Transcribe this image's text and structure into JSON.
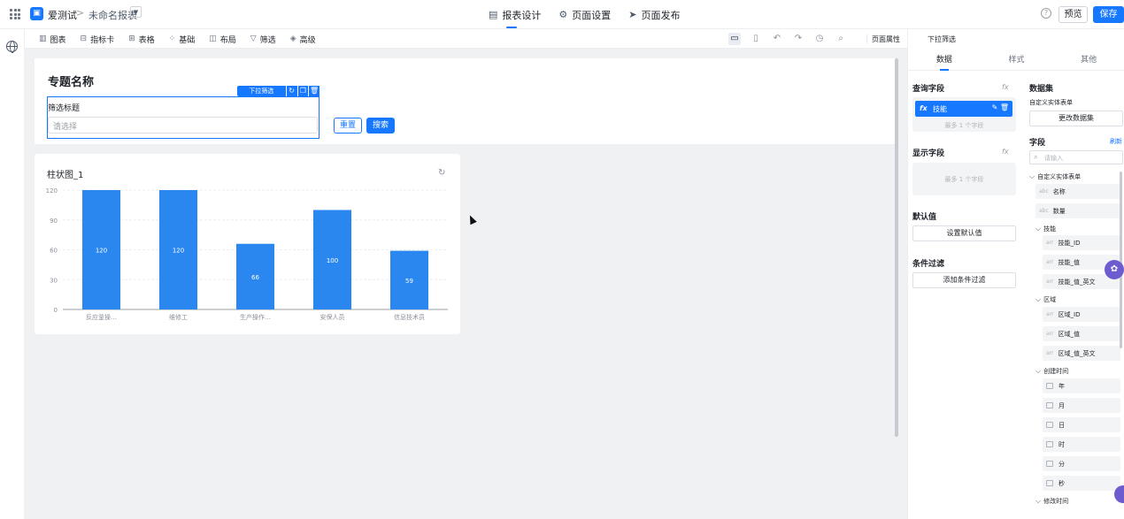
{
  "topbar": {
    "app_name": "爱测试",
    "crumb_sep": ">",
    "report_name": "未命名报表",
    "tabs": [
      {
        "label": "报表设计",
        "icon": "report-design-icon"
      },
      {
        "label": "页面设置",
        "icon": "gear-icon"
      },
      {
        "label": "页面发布",
        "icon": "send-icon"
      }
    ],
    "preview_label": "预览",
    "save_label": "保存"
  },
  "toolbar": {
    "items": [
      {
        "label": "图表",
        "icon": "bar-chart-icon"
      },
      {
        "label": "指标卡",
        "icon": "indicator-card-icon"
      },
      {
        "label": "表格",
        "icon": "table-icon"
      },
      {
        "label": "基础",
        "icon": "basic-grid-icon"
      },
      {
        "label": "布局",
        "icon": "layout-icon"
      },
      {
        "label": "筛选",
        "icon": "filter-icon"
      },
      {
        "label": "高级",
        "icon": "advanced-layers-icon"
      }
    ],
    "page_prop_label": "页面属性"
  },
  "canvas": {
    "topic_title": "专题名称",
    "filter": {
      "title": "筛选标题",
      "placeholder": "请选择",
      "tag_label": "下拉筛选"
    },
    "reset_label": "重置",
    "search_label": "搜索"
  },
  "chart_data": {
    "type": "bar",
    "title": "柱状图_1",
    "categories": [
      "反应釜操…",
      "维修工",
      "生产操作…",
      "安保人员",
      "信息技术员"
    ],
    "values": [
      120,
      120,
      66,
      100,
      59
    ],
    "yticks": [
      0,
      30,
      60,
      90,
      120
    ],
    "ylim": [
      0,
      120
    ],
    "color": "#2b87f0",
    "grid": true
  },
  "panel": {
    "header_title": "下拉筛选",
    "tabs": [
      "数据",
      "样式",
      "其他"
    ],
    "query_field_title": "查询字段",
    "query_field_value": "技能",
    "query_hint": "最多 1 个字段",
    "display_field_title": "显示字段",
    "display_hint": "最多 1 个字段",
    "default_title": "默认值",
    "default_btn": "设置默认值",
    "cond_title": "条件过滤",
    "cond_btn": "添加条件过滤",
    "fx_label": "fx",
    "dataset_title": "数据集",
    "dataset_name": "自定义实体表单",
    "change_dataset_btn": "更改数据集",
    "field_title": "字段",
    "refresh_label": "刷新",
    "search_placeholder": "请输入",
    "tree": {
      "root": "自定义实体表单",
      "root_items": [
        {
          "type": "abc",
          "label": "名称"
        },
        {
          "type": "abc",
          "label": "数量"
        }
      ],
      "groups": [
        {
          "label": "技能",
          "items": [
            {
              "type": "arr",
              "label": "技能_ID"
            },
            {
              "type": "arr",
              "label": "技能_值"
            },
            {
              "type": "arr",
              "label": "技能_值_英文"
            }
          ]
        },
        {
          "label": "区域",
          "items": [
            {
              "type": "arr",
              "label": "区域_ID"
            },
            {
              "type": "arr",
              "label": "区域_值"
            },
            {
              "type": "arr",
              "label": "区域_值_英文"
            }
          ]
        },
        {
          "label": "创建时间",
          "items": [
            {
              "type": "date",
              "label": "年"
            },
            {
              "type": "date",
              "label": "月"
            },
            {
              "type": "date",
              "label": "日"
            },
            {
              "type": "date",
              "label": "时"
            },
            {
              "type": "date",
              "label": "分"
            },
            {
              "type": "date",
              "label": "秒"
            }
          ]
        },
        {
          "label": "修改时间",
          "items": []
        }
      ]
    }
  }
}
